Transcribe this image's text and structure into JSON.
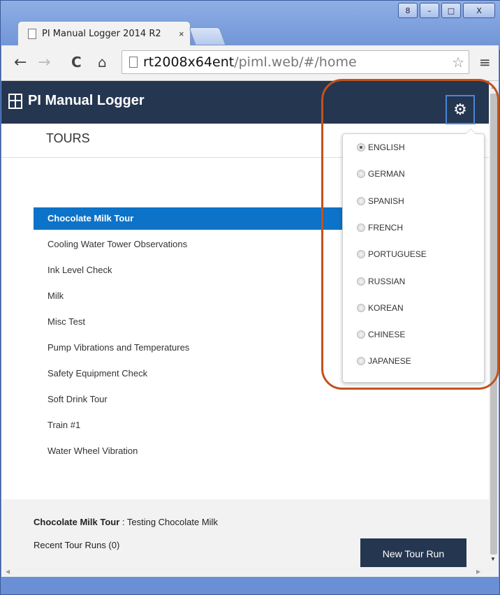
{
  "browser": {
    "tab_title": "PI Manual Logger 2014 R2",
    "tab_close": "×",
    "url_host": "rt2008x64ent",
    "url_path": "/piml.web/#/home",
    "back": "←",
    "forward": "→",
    "reload": "C",
    "home": "⌂",
    "star": "☆",
    "menu": "≡",
    "win_user": "8",
    "win_min": "–",
    "win_max": "□",
    "win_close": "X"
  },
  "app": {
    "title": "PI Manual Logger",
    "section_title": "TOURS",
    "settings_icon": "⚙"
  },
  "tours": [
    {
      "label": "Chocolate Milk Tour",
      "active": true
    },
    {
      "label": "Cooling Water Tower Observations",
      "active": false
    },
    {
      "label": "Ink Level Check",
      "active": false
    },
    {
      "label": "Milk",
      "active": false
    },
    {
      "label": "Misc Test",
      "active": false
    },
    {
      "label": "Pump Vibrations and Temperatures",
      "active": false
    },
    {
      "label": "Safety Equipment Check",
      "active": false
    },
    {
      "label": "Soft Drink Tour",
      "active": false
    },
    {
      "label": "Train #1",
      "active": false
    },
    {
      "label": "Water Wheel Vibration",
      "active": false
    }
  ],
  "footer": {
    "selected_tour": "Chocolate Milk Tour",
    "selected_desc": " : Testing Chocolate Milk",
    "recent_runs": "Recent Tour Runs (0)",
    "new_run_button": "New Tour Run"
  },
  "languages": [
    {
      "label": "ENGLISH",
      "selected": true
    },
    {
      "label": "GERMAN",
      "selected": false
    },
    {
      "label": "SPANISH",
      "selected": false
    },
    {
      "label": "FRENCH",
      "selected": false
    },
    {
      "label": "PORTUGUESE",
      "selected": false
    },
    {
      "label": "RUSSIAN",
      "selected": false
    },
    {
      "label": "KOREAN",
      "selected": false
    },
    {
      "label": "CHINESE",
      "selected": false
    },
    {
      "label": "JAPANESE",
      "selected": false
    }
  ],
  "colors": {
    "app_bar": "#253650",
    "active_item": "#0d73c8",
    "highlight": "#c2521c"
  }
}
